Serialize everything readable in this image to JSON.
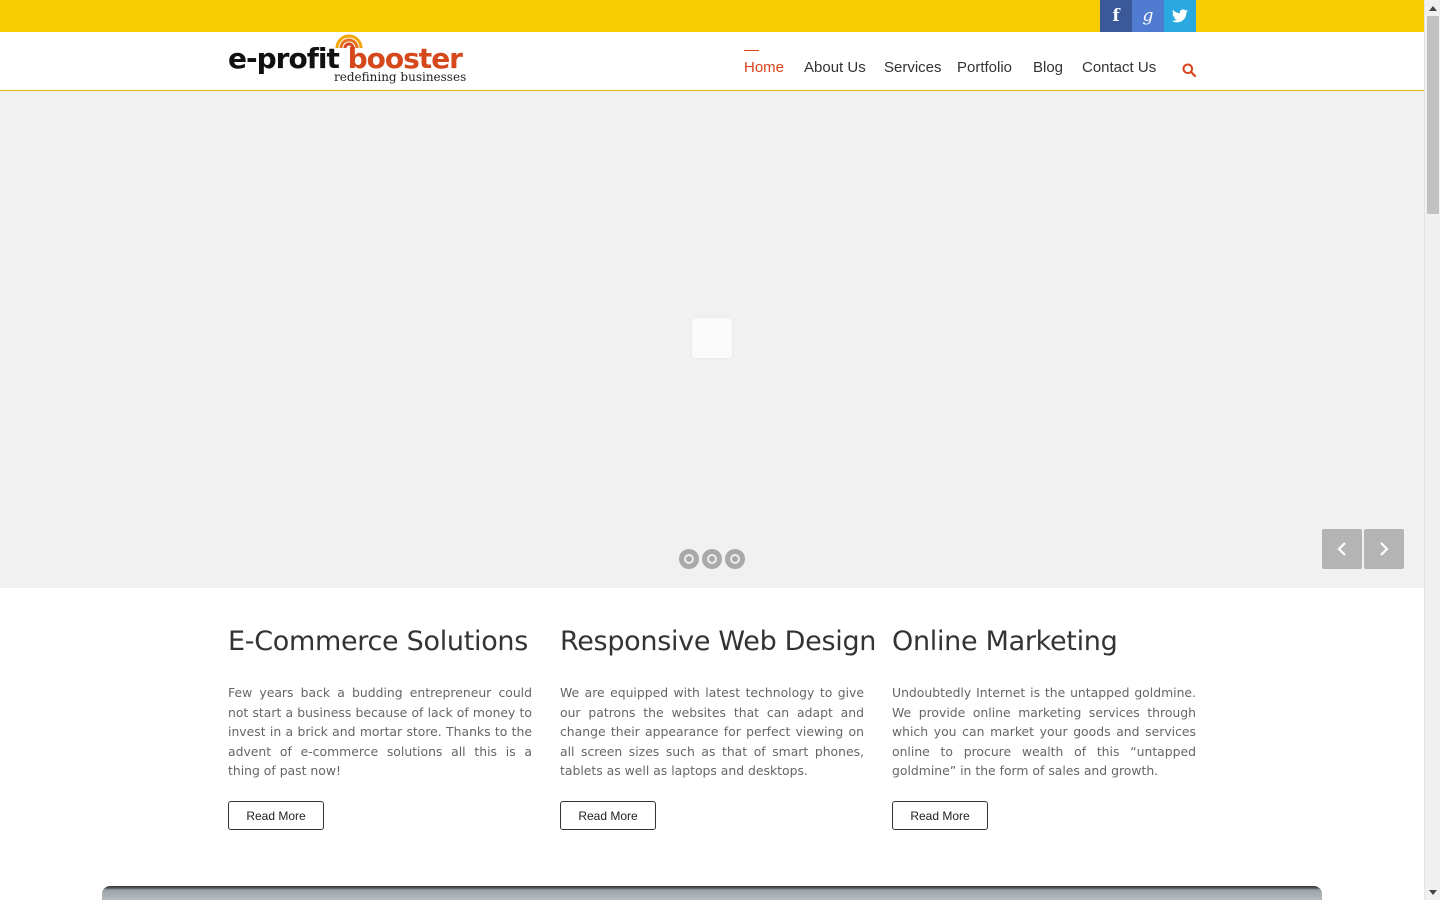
{
  "social": {
    "facebook": {
      "glyph": "f",
      "icon": "facebook-icon"
    },
    "googleplus": {
      "glyph": "g",
      "icon": "google-plus-icon"
    },
    "twitter": {
      "icon": "twitter-icon"
    }
  },
  "brand": {
    "name_part1": "e-profit ",
    "name_part2": "booster",
    "tagline": "redefining businesses"
  },
  "nav": {
    "items": [
      {
        "label": "Home",
        "active": true
      },
      {
        "label": "About Us"
      },
      {
        "label": "Services"
      },
      {
        "label": "Portfolio"
      },
      {
        "label": "Blog"
      },
      {
        "label": "Contact Us"
      }
    ]
  },
  "columns": [
    {
      "title": "E-Commerce Solutions",
      "text": "Few years back a budding entrepreneur could not start a business because of lack of money to invest in a brick and mortar store. Thanks to the advent of e-commerce solutions all this is a thing of past now!",
      "button": "Read More"
    },
    {
      "title": "Responsive Web Design",
      "text": "We are equipped with latest technology to give our patrons the websites that can adapt and change their appearance for perfect viewing on all screen sizes such as that of smart phones, tablets as well as laptops and desktops.",
      "button": "Read More"
    },
    {
      "title": "Online Marketing",
      "text": "Undoubtedly Internet is the untapped goldmine. We provide online marketing services through which you can market your goods and services online to procure wealth of this “untapped goldmine” in the form of sales and growth.",
      "button": "Read More"
    }
  ],
  "colors": {
    "topbar": "#f6cd00",
    "accent": "#d8421c",
    "facebook": "#3b5998",
    "googleplus": "#4f7bd1",
    "twitter": "#2aa9e0"
  }
}
